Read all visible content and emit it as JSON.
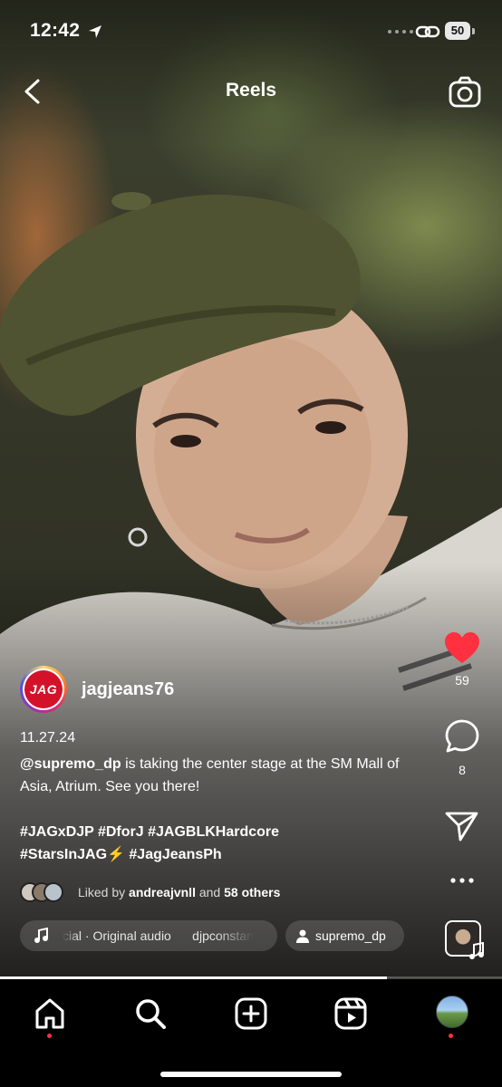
{
  "status_bar": {
    "time": "12:42",
    "battery": "50"
  },
  "header": {
    "title": "Reels"
  },
  "post": {
    "username": "jagjeans76",
    "avatar_logo_text": "JAG",
    "date": "11.27.24",
    "caption_mention": "@supremo_dp",
    "caption_text": " is taking the center stage at the SM Mall of Asia, Atrium. See you there!",
    "hashtags_line1": "#JAGxDJP #DforJ #JAGBLKHardcore",
    "hashtags_line2": "#StarsInJAG⚡ #JagJeansPh",
    "liked_by_prefix": "Liked by ",
    "liked_by_user": "andreajvnll",
    "liked_by_and": " and ",
    "liked_by_others": "58 others",
    "audio_text": "cial · Original audio      djpconstan",
    "tagged_user": "supremo_dp",
    "progress_fraction": 0.77
  },
  "actions": {
    "likes": "59",
    "comments": "8"
  },
  "icons": {
    "back": "chevron-left-icon",
    "camera": "camera-icon",
    "like": "heart-filled-icon",
    "comment": "comment-bubble-icon",
    "share": "paper-plane-icon",
    "more": "more-dots-icon",
    "music": "music-note-icon",
    "person": "person-icon"
  },
  "colors": {
    "like_red": "#ff3040",
    "notification_dot": "#ff3040",
    "brand_jag_red": "#d3122a"
  },
  "tab_bar": {
    "items": [
      "home",
      "search",
      "create",
      "reels",
      "profile"
    ],
    "active": "home"
  }
}
